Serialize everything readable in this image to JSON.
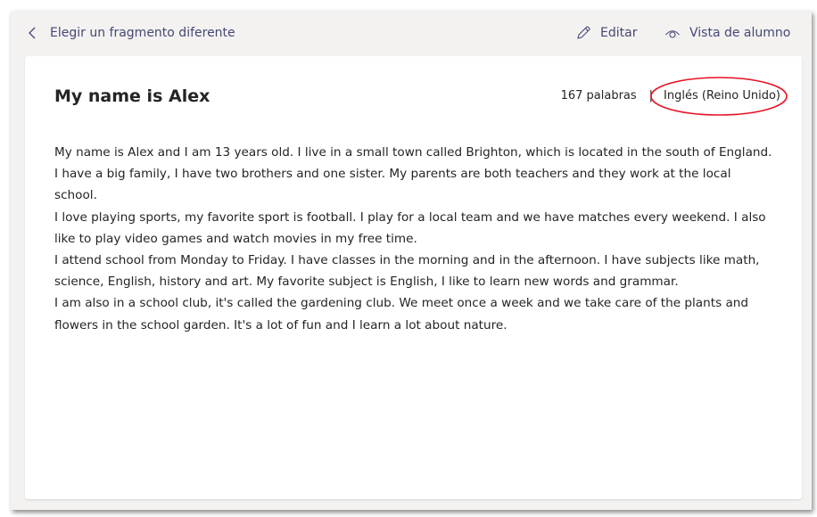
{
  "topbar": {
    "back_label": "Elegir un fragmento diferente",
    "edit_label": "Editar",
    "student_view_label": "Vista de alumno"
  },
  "passage": {
    "title": "My name is Alex",
    "word_count": "167 palabras",
    "separator": "|",
    "language": "Inglés (Reino Unido)",
    "paragraphs": [
      "My name is Alex and I am 13 years old. I live in a small town called Brighton, which is located in the south of England. I have a big family, I have two brothers and one sister. My parents are both teachers and they work at the local school.",
      "I love playing sports, my favorite sport is football. I play for a local team and we have matches every weekend. I also like to play video games and watch movies in my free time.",
      "I attend school from Monday to Friday. I have classes in the morning and in the afternoon. I have subjects like math, science, English, history and art. My favorite subject is English, I like to learn new words and grammar.",
      "I am also in a school club, it's called the gardening club. We meet once a week and we take care of the plants and flowers in the school garden. It's a lot of fun and I learn a lot about nature."
    ]
  },
  "colors": {
    "link": "#464775",
    "highlight_ring": "#e81123",
    "background": "#f3f2f1",
    "card": "#ffffff",
    "text": "#252423"
  },
  "icons": {
    "back": "chevron-left-icon",
    "edit": "pencil-icon",
    "student_view": "eye-icon"
  }
}
